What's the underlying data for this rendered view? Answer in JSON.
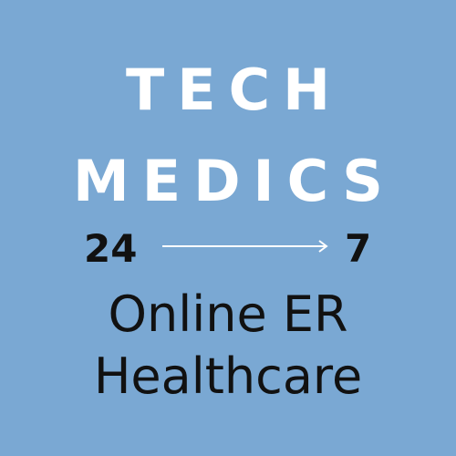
{
  "title": {
    "line1": "TECH",
    "line2": "MEDICS"
  },
  "hours": {
    "left": "24",
    "right": "7"
  },
  "subtitle": {
    "line1": "Online ER",
    "line2": "Healthcare"
  },
  "colors": {
    "background": "#7aa8d3",
    "title": "#ffffff",
    "text": "#111111",
    "arrow": "#ffffff"
  },
  "icons": {
    "arrow": "right-arrow-icon"
  }
}
